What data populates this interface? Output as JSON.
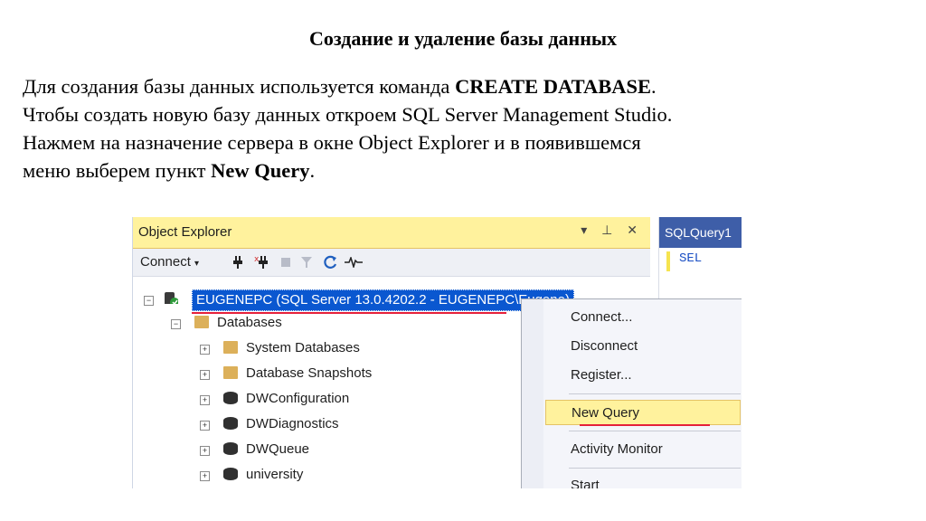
{
  "doc": {
    "title": "Создание и удаление базы данных",
    "line1_pre": "Для создания базы данных используется команда ",
    "line1_bold": "CREATE DATABASE",
    "line1_post": ".",
    "line2": "Чтобы создать новую базу данных откроем SQL Server Management Studio.",
    "line3": "Нажмем на назначение сервера в окне Object Explorer и в появившемся",
    "line4_pre": "меню выберем пункт ",
    "line4_bold": "New Query",
    "line4_post": "."
  },
  "object_explorer": {
    "title": "Object Explorer",
    "header_icons": "▾ ⊥ ✕",
    "toolbar": {
      "connect": "Connect",
      "connect_arrow": "▾"
    },
    "server": "EUGENEPC (SQL Server 13.0.4202.2 - EUGENEPC\\Eugene)",
    "databases": "Databases",
    "items": [
      {
        "label": "System Databases",
        "type": "folder"
      },
      {
        "label": "Database Snapshots",
        "type": "folder"
      },
      {
        "label": "DWConfiguration",
        "type": "db"
      },
      {
        "label": "DWDiagnostics",
        "type": "db"
      },
      {
        "label": "DWQueue",
        "type": "db"
      },
      {
        "label": "university",
        "type": "db"
      }
    ]
  },
  "query_tab": {
    "title": "SQLQuery1",
    "code": "SEL"
  },
  "context_menu": {
    "items": [
      "Connect...",
      "Disconnect",
      "Register...",
      "New Query",
      "Activity Monitor",
      "Start"
    ]
  }
}
